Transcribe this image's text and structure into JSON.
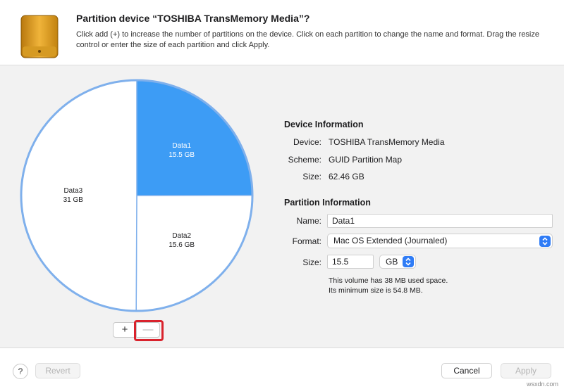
{
  "dialog": {
    "title": "Partition device “TOSHIBA TransMemory Media”?",
    "description": "Click add (+) to increase the number of partitions on the device. Click on each partition to change the name and format. Drag the resize control or enter the size of each partition and click Apply."
  },
  "pie": {
    "partitions": [
      {
        "name": "Data1",
        "size": "15.5 GB",
        "size_gb": 15.5,
        "selected": true
      },
      {
        "name": "Data2",
        "size": "15.6 GB",
        "size_gb": 15.6,
        "selected": false
      },
      {
        "name": "Data3",
        "size": "31 GB",
        "size_gb": 31,
        "selected": false
      }
    ],
    "selected_color": "#3d9cf5",
    "outline_color": "#7fb0ec"
  },
  "controls": {
    "add_label": "+",
    "remove_label": "—"
  },
  "device_info": {
    "heading": "Device Information",
    "device_label": "Device:",
    "device_value": "TOSHIBA TransMemory Media",
    "scheme_label": "Scheme:",
    "scheme_value": "GUID Partition Map",
    "size_label": "Size:",
    "size_value": "62.46 GB"
  },
  "partition_info": {
    "heading": "Partition Information",
    "name_label": "Name:",
    "name_value": "Data1",
    "format_label": "Format:",
    "format_value": "Mac OS Extended (Journaled)",
    "size_label": "Size:",
    "size_value": "15.5",
    "unit_value": "GB",
    "note_line1": "This volume has 38 MB used space.",
    "note_line2": "Its minimum size is 54.8 MB."
  },
  "footer": {
    "help_label": "?",
    "revert_label": "Revert",
    "cancel_label": "Cancel",
    "apply_label": "Apply"
  },
  "watermark": "wsxdn.com",
  "accent_color": "#2f7cf6",
  "highlight_color": "#d9232d"
}
